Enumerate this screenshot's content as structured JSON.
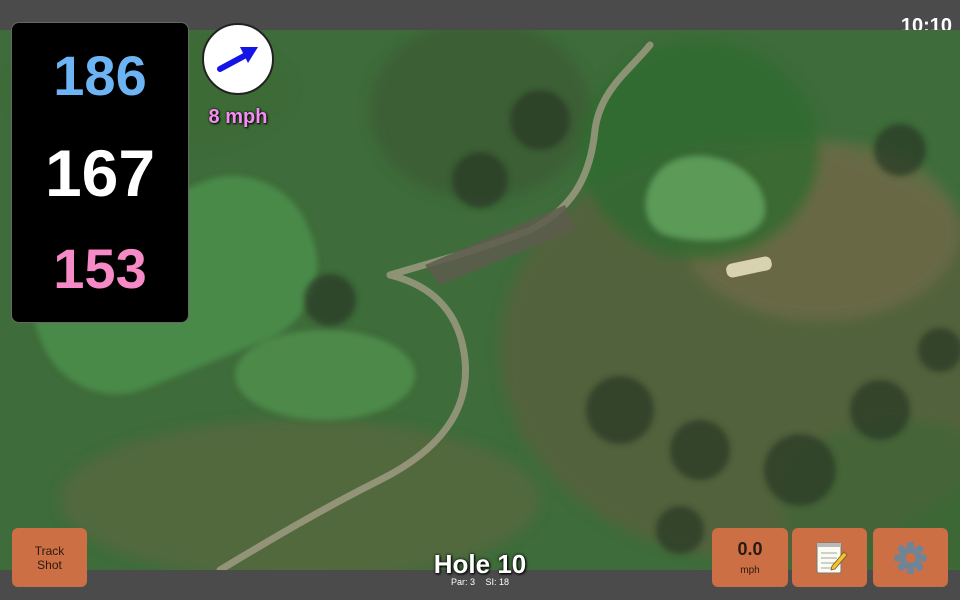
{
  "status": {
    "clock": "10:10"
  },
  "distances": {
    "back": "186",
    "middle": "167",
    "front": "153"
  },
  "wind": {
    "speed_label": "8 mph",
    "icon": "wind-direction-arrow-icon",
    "arrow_color": "#1414e6"
  },
  "hole": {
    "title": "Hole 10",
    "par": "Par: 3",
    "stroke_index": "SI: 18"
  },
  "buttons": {
    "track_shot": "Track\nShot",
    "speed_value": "0.0",
    "speed_unit": "mph",
    "notes_icon": "notepad-icon",
    "settings_icon": "gear-icon"
  },
  "colors": {
    "back": "#6db4f5",
    "middle": "#ffffff",
    "front": "#f68ac7",
    "button": "#cd6f45",
    "wind_text": "#f48df2"
  }
}
